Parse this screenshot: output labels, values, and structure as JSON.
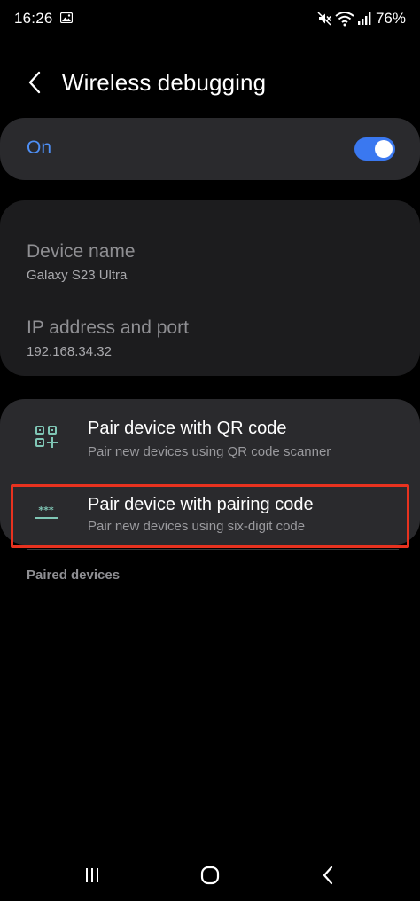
{
  "status_bar": {
    "time": "16:26",
    "battery": "76%"
  },
  "header": {
    "title": "Wireless debugging"
  },
  "toggle": {
    "label": "On",
    "state": "on",
    "accent_color": "#4e8ff5"
  },
  "device_info": {
    "device_name_label": "Device name",
    "device_name_value": "Galaxy S23 Ultra",
    "ip_label": "IP address and port",
    "ip_value": "192.168.34.32"
  },
  "pairing": {
    "qr": {
      "title": "Pair device with QR code",
      "subtitle": "Pair new devices using QR code scanner",
      "icon": "qr-code-icon"
    },
    "code": {
      "title": "Pair device with pairing code",
      "subtitle": "Pair new devices using six-digit code",
      "icon": "pairing-code-icon",
      "highlight_color": "#e8321f"
    }
  },
  "paired_devices": {
    "header": "Paired devices"
  },
  "nav": {
    "recents": "recents-icon",
    "home": "home-icon",
    "back": "back-icon"
  }
}
